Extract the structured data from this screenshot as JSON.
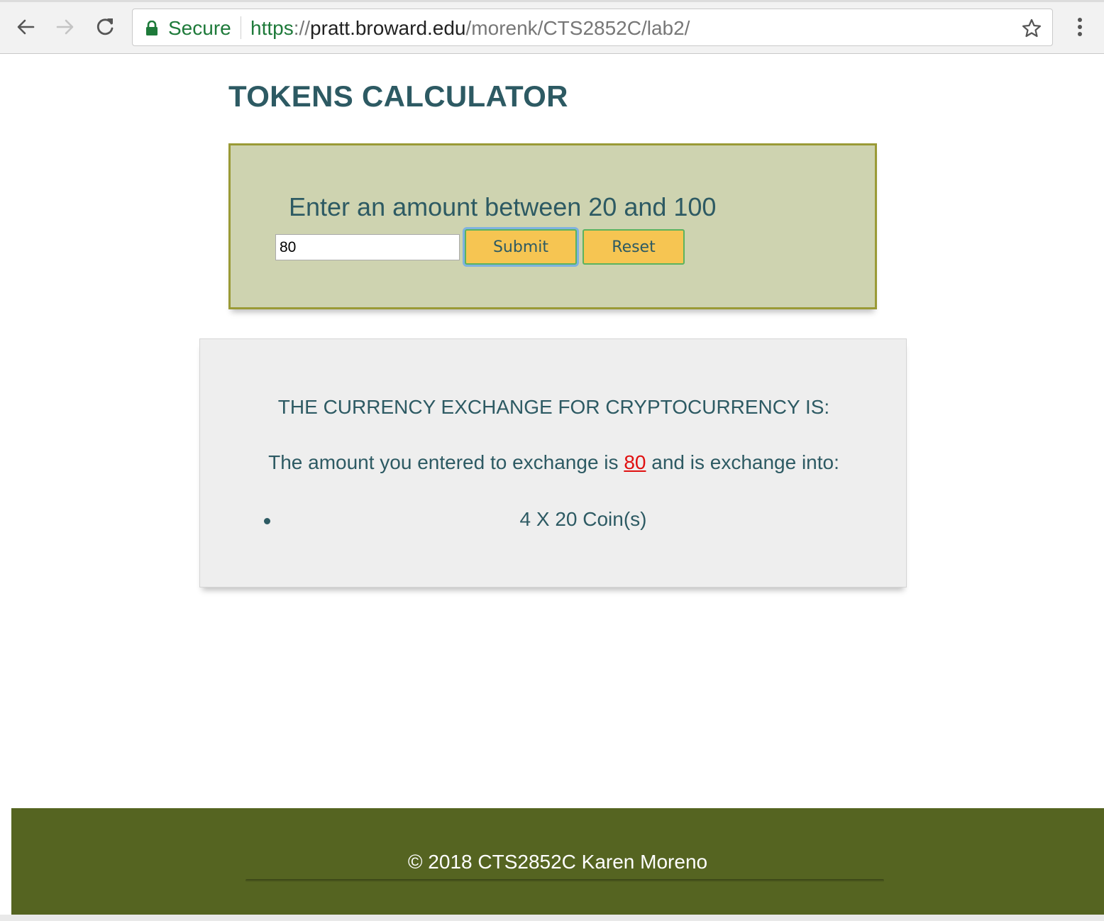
{
  "browser": {
    "secure_label": "Secure",
    "url_scheme": "https",
    "url_sep": "://",
    "url_host": "pratt.broward.edu",
    "url_path": "/morenk/CTS2852C/lab2/",
    "icons": [
      "back-arrow-icon",
      "forward-arrow-icon",
      "reload-icon",
      "lock-icon",
      "star-icon",
      "more-vert-icon"
    ]
  },
  "page": {
    "title": "TOKENS CALCULATOR"
  },
  "form": {
    "prompt": "Enter an amount between 20 and 100",
    "amount_value": "80",
    "submit_label": "Submit",
    "reset_label": "Reset"
  },
  "result": {
    "heading": "THE CURRENCY EXCHANGE FOR CRYPTOCURRENCY IS:",
    "line_prefix": "The amount you entered to exchange is ",
    "amount": "80",
    "line_suffix": " and is exchange into:",
    "coins": [
      "4 X 20 Coin(s)"
    ]
  },
  "footer": {
    "text": "© 2018 CTS2852C Karen Moreno"
  },
  "colors": {
    "heading_text": "#2d5a63",
    "form_bg": "#ced3b0",
    "form_border": "#9a9a36",
    "button_bg": "#f6c552",
    "button_border": "#5bb35f",
    "result_bg": "#eeeeee",
    "amount_highlight": "#e01010",
    "footer_bg": "#556421",
    "secure_green": "#1e7a3a"
  }
}
